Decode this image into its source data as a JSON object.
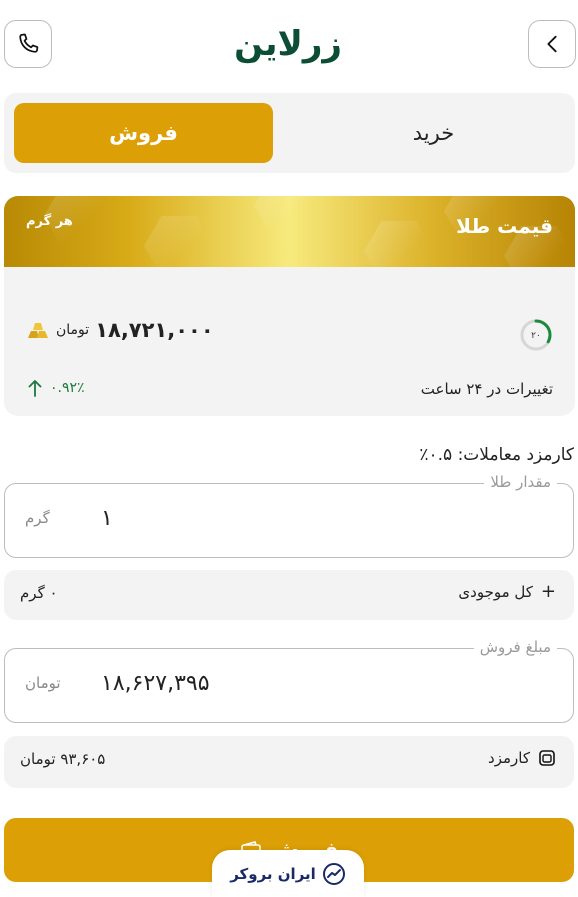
{
  "header": {
    "logo_text": "زرلاین",
    "back_icon": "chevron-right-icon",
    "call_icon": "phone-icon"
  },
  "tabs": {
    "buy_label": "خرید",
    "sell_label": "فروش",
    "active": "sell"
  },
  "price_card": {
    "title": "قیمت طلا",
    "subtitle": "هر گرم",
    "price": "۱۸,۷۲۱,۰۰۰",
    "unit": "تومان",
    "timer_value": "۲۰",
    "timer_fraction": 0.33,
    "change_label": "تغییرات در ۲۴ ساعت",
    "change_value": "۰.۹۲٪"
  },
  "fee_note": "کارمزد معاملات: ۰.۵٪",
  "amount_field": {
    "label": "مقدار طلا",
    "value": "۱",
    "unit": "گرم"
  },
  "balance_row": {
    "label": "کل موجودی",
    "value": "۰ گرم"
  },
  "sell_amount_field": {
    "label": "مبلغ فروش",
    "value": "۱۸,۶۲۷,۳۹۵",
    "unit": "تومان"
  },
  "fee_row": {
    "label": "کارمزد",
    "value": "۹۳,۶۰۵ تومان"
  },
  "submit": {
    "label": "فروش"
  },
  "brand_badge": {
    "text": "ایران بروکر"
  },
  "colors": {
    "accent": "#dc9f06",
    "brand_green": "#0c4d35",
    "up_green": "#1a7a3b"
  }
}
